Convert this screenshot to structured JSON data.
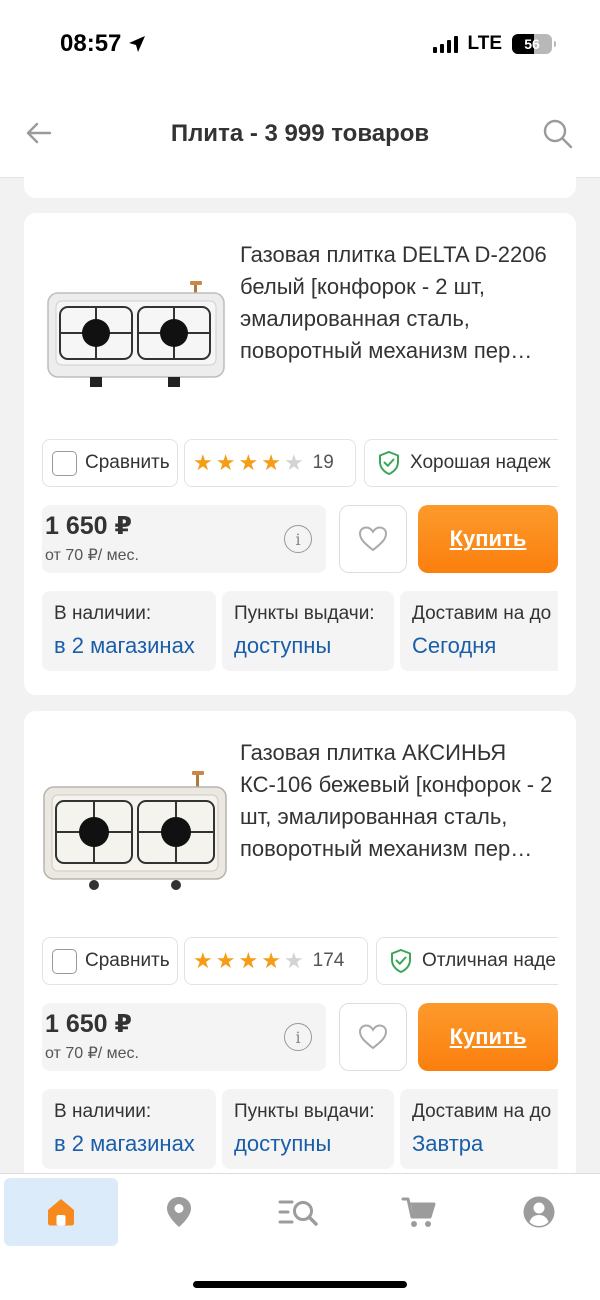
{
  "status_bar": {
    "time": "08:57",
    "network": "LTE",
    "battery": "56"
  },
  "header": {
    "title": "Плита - 3 999 товаров"
  },
  "products": [
    {
      "title": "Газовая плитка DELTA D-2206 белый [конфорок - 2 шт, эмалированная сталь, поворотный механизм пер…",
      "compare_label": "Сравнить",
      "rating": 4,
      "reviews": "19",
      "reliability": "Хорошая надеж",
      "price": "1 650 ₽",
      "monthly": "от 70 ₽/ мес.",
      "buy_label": "Купить",
      "availability": {
        "label": "В наличии:",
        "value": "в 2 магазинах"
      },
      "pickup": {
        "label": "Пункты выдачи:",
        "value": "доступны"
      },
      "delivery": {
        "label": "Доставим на до",
        "value": "Сегодня"
      }
    },
    {
      "title": "Газовая плитка АКСИНЬЯ КС-106 бежевый [конфорок - 2 шт, эмалированная сталь, поворотный механизм пер…",
      "compare_label": "Сравнить",
      "rating": 4,
      "reviews": "174",
      "reliability": "Отличная наде",
      "price": "1 650 ₽",
      "monthly": "от 70 ₽/ мес.",
      "buy_label": "Купить",
      "availability": {
        "label": "В наличии:",
        "value": "в 2 магазинах"
      },
      "pickup": {
        "label": "Пункты выдачи:",
        "value": "доступны"
      },
      "delivery": {
        "label": "Доставим на до",
        "value": "Завтра"
      }
    }
  ],
  "tabbar": {
    "items": [
      {
        "icon": "home-icon",
        "active": true
      },
      {
        "icon": "location-pin-icon",
        "active": false
      },
      {
        "icon": "catalog-search-icon",
        "active": false
      },
      {
        "icon": "cart-icon",
        "active": false
      },
      {
        "icon": "profile-icon",
        "active": false
      }
    ]
  },
  "colors": {
    "accent_orange": "#fb8a1c",
    "link_blue": "#1a5ea8",
    "star": "#f59d17",
    "shield_green": "#3aa757",
    "active_tab": "#dcebfa"
  }
}
